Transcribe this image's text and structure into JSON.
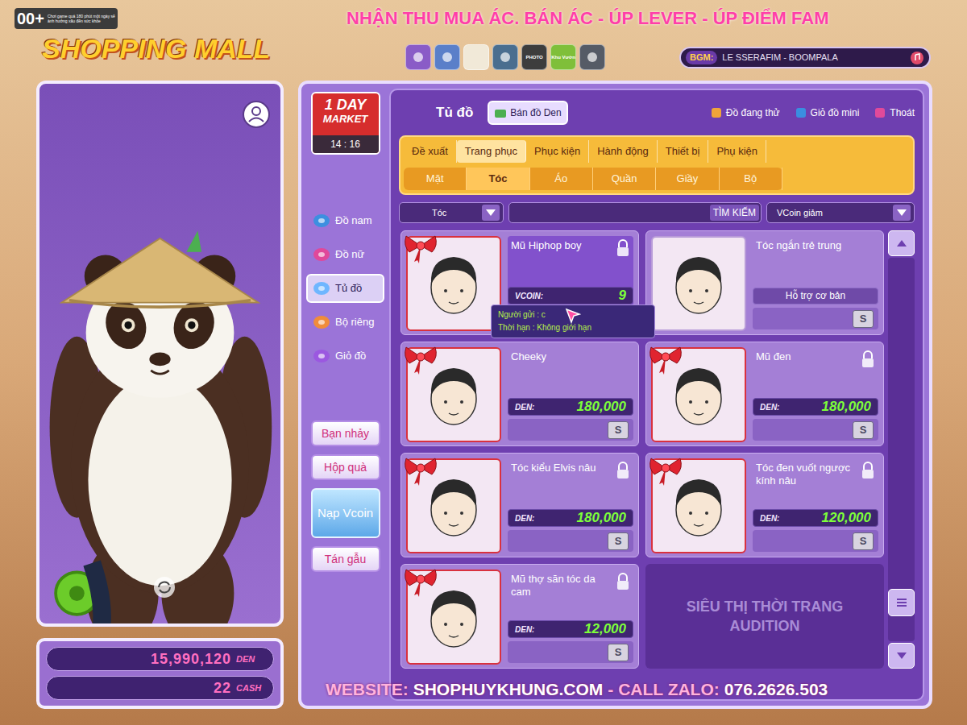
{
  "age_badge": {
    "rating": "00+",
    "warning": "Chơi game quá 180 phút một ngày sẽ ảnh hưởng xấu đến sức khỏe"
  },
  "logo": "SHOPPING MALL",
  "watermark_top": "NHẬN THU MUA ÁC. BÁN ÁC - ÚP LEVER - ÚP ĐIỂM FAM",
  "watermark_bottom": [
    {
      "text": "WEBSITE:",
      "emphasis": false
    },
    {
      "text": "SHOPHUYKHUNG.COM",
      "emphasis": true
    },
    {
      "text": "- CALL ZALO:",
      "emphasis": false
    },
    {
      "text": "076.2626.503",
      "emphasis": true
    }
  ],
  "toolbar": [
    {
      "kind": "bag"
    },
    {
      "kind": "face"
    },
    {
      "kind": "blank"
    },
    {
      "kind": "tv"
    },
    {
      "kind": "photo",
      "label": "PHOTO"
    },
    {
      "kind": "garden",
      "label": "Khu Vườn"
    },
    {
      "kind": "cloud"
    }
  ],
  "bgm": {
    "label": "BGM:",
    "track": "LE SSERAFIM - BOOMPALA"
  },
  "currency": [
    {
      "amount": "15,990,120",
      "unit": "DEN"
    },
    {
      "amount": "22",
      "unit": "CASH"
    }
  ],
  "market": {
    "line1": "1 DAY",
    "line2": "MARKET",
    "time": "14 : 16"
  },
  "nav": [
    {
      "label": "Đồ nam",
      "selected": false
    },
    {
      "label": "Đồ nữ",
      "selected": false
    },
    {
      "label": "Tủ đồ",
      "selected": true
    },
    {
      "label": "Bộ riêng",
      "selected": false
    },
    {
      "label": "Giỏ đồ",
      "selected": false
    }
  ],
  "side_buttons": [
    {
      "label": "Bạn nhảy",
      "kind": "plain"
    },
    {
      "label": "Hộp quà",
      "kind": "plain"
    },
    {
      "label": "Nạp Vcoin",
      "kind": "topup"
    },
    {
      "label": "Tán gẫu",
      "kind": "plain"
    }
  ],
  "wardrobe": {
    "title": "Tủ đồ",
    "sell_button": "Bán đồ Den",
    "links": [
      "Đồ đang thử",
      "Giỏ đồ mini",
      "Thoát"
    ]
  },
  "category_tabs": [
    {
      "label": "Đề xuất",
      "selected": false
    },
    {
      "label": "Trang phục",
      "selected": true
    },
    {
      "label": "Phục kiện",
      "selected": false
    },
    {
      "label": "Hành động",
      "selected": false
    },
    {
      "label": "Thiết bị",
      "selected": false
    },
    {
      "label": "Phụ kiện",
      "selected": false
    }
  ],
  "sub_tabs": [
    {
      "label": "Mặt",
      "selected": false
    },
    {
      "label": "Tóc",
      "selected": true
    },
    {
      "label": "Áo",
      "selected": false
    },
    {
      "label": "Quần",
      "selected": false
    },
    {
      "label": "Giầy",
      "selected": false
    },
    {
      "label": "Bộ",
      "selected": false
    }
  ],
  "filter": {
    "category": "Tóc",
    "search_value": "",
    "search_button": "TÌM KIẾM",
    "sort": "VCoin giảm"
  },
  "items": [
    {
      "name": "Mũ Hiphop boy",
      "kind": "priced",
      "currency_label": "VCOIN:",
      "price": "9",
      "gift": true,
      "locked": true,
      "selected": true
    },
    {
      "name": "Tóc ngắn trẻ trung",
      "kind": "basic",
      "note": "Hỗ trợ cơ bản",
      "gift": false,
      "locked": false,
      "selected": false,
      "action": "S"
    },
    {
      "name": "Cheeky",
      "kind": "priced",
      "currency_label": "DEN:",
      "price": "180,000",
      "gift": true,
      "locked": false,
      "selected": false,
      "action": "S"
    },
    {
      "name": "Mũ đen",
      "kind": "priced",
      "currency_label": "DEN:",
      "price": "180,000",
      "gift": true,
      "locked": true,
      "selected": false,
      "action": "S"
    },
    {
      "name": "Tóc kiểu Elvis nâu",
      "kind": "priced",
      "currency_label": "DEN:",
      "price": "180,000",
      "gift": true,
      "locked": true,
      "selected": false,
      "action": "S"
    },
    {
      "name": "Tóc đen vuốt ngược kính nâu",
      "kind": "priced",
      "currency_label": "DEN:",
      "price": "120,000",
      "gift": true,
      "locked": true,
      "selected": false,
      "action": "S"
    },
    {
      "name": "Mũ thợ săn tóc da cam",
      "kind": "priced",
      "currency_label": "DEN:",
      "price": "12,000",
      "gift": true,
      "locked": true,
      "selected": false,
      "action": "S"
    }
  ],
  "empty_slot": "SIÊU THỊ THỜI TRANG AUDITION",
  "tooltip": {
    "lines": [
      "Người gửi : c",
      "Thời hạn : Không giới hạn"
    ]
  },
  "scroll_position": 0.93
}
